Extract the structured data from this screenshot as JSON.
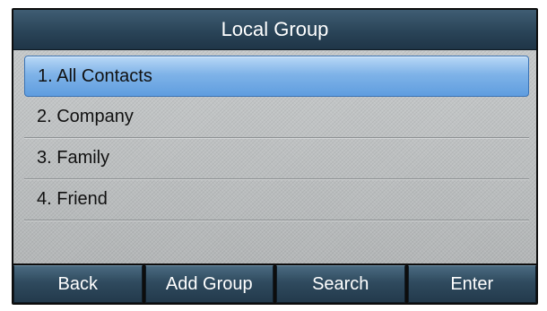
{
  "title": "Local Group",
  "list": {
    "items": [
      {
        "label": "1. All Contacts"
      },
      {
        "label": "2. Company"
      },
      {
        "label": "3. Family"
      },
      {
        "label": "4. Friend"
      }
    ],
    "selected_index": 0
  },
  "softkeys": [
    {
      "label": "Back"
    },
    {
      "label": "Add Group"
    },
    {
      "label": "Search"
    },
    {
      "label": "Enter"
    }
  ],
  "colors": {
    "title_bar": "#2a4458",
    "selection": "#7fb3e8",
    "background": "#b9bcbd"
  }
}
